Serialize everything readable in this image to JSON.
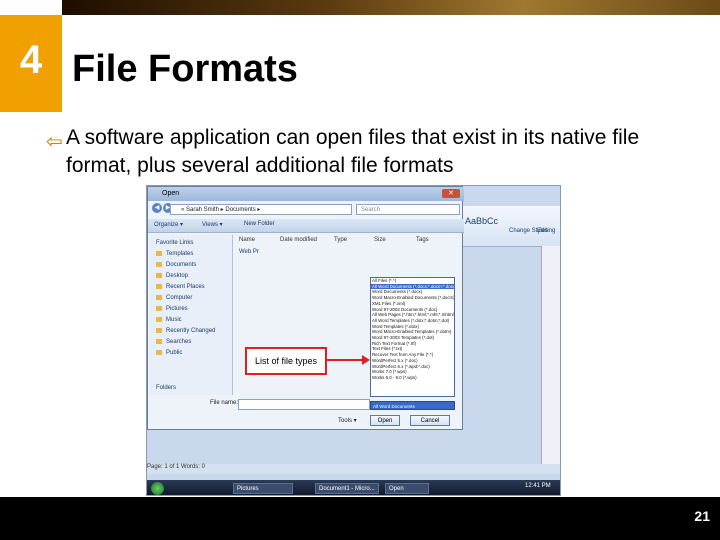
{
  "slide": {
    "chapter_number": "4",
    "title": "File Formats",
    "bullet": "A software application can open files that exist in its native file format, plus several additional file formats",
    "page_number": "21",
    "accent_color": "#f0a000"
  },
  "dialog": {
    "title": "Open",
    "close_glyph": "✕",
    "address": "« Sarah Smith ▸ Documents ▸",
    "search_placeholder": "Search",
    "toolbar": {
      "organize": "Organize ▾",
      "views": "Views ▾",
      "new_folder": "New Folder"
    },
    "favorite_links_header": "Favorite Links",
    "favorites": [
      "Templates",
      "Documents",
      "Desktop",
      "Recent Places",
      "Computer",
      "Pictures",
      "Music",
      "Recently Changed",
      "Searches",
      "Public"
    ],
    "folders_label": "Folders",
    "columns": [
      "Name",
      "Date modified",
      "Type",
      "Size",
      "Tags"
    ],
    "files": [
      "Web Pr"
    ],
    "file_name_label": "File name:",
    "tools_label": "Tools ▾",
    "file_types": [
      "All Files (*.*)",
      "All Word Documents (*.docx;*.docm;*.dotx;*.dotm;*.doc;*.dot;*.htm;*.html;*.rtf)",
      "Word Documents (*.docx)",
      "Word Macro-Enabled Documents (*.docm)",
      "XML Files (*.xml)",
      "Word 97-2003 Documents (*.doc)",
      "All Web Pages (*.htm;*.html;*.mht;*.mhtml)",
      "All Word Templates (*.dotx;*.dotm;*.dot)",
      "Word Templates (*.dotx)",
      "Word Macro-Enabled Templates (*.dotm)",
      "Word 97-2003 Templates (*.dot)",
      "Rich Text Format (*.rtf)",
      "Text Files (*.txt)",
      "Recover Text from Any File (*.*)",
      "WordPerfect 5.x (*.doc)",
      "WordPerfect 6.x (*.wpd;*.doc)",
      "Works 7.0 (*.wps)",
      "Works 6.0 - 9.0 (*.wps)"
    ],
    "file_type_selected": "All Word Documents",
    "open_label": "Open",
    "cancel_label": "Cancel"
  },
  "callout": {
    "label": "List of file types"
  },
  "word": {
    "ribbon": [
      "AaBbCc",
      "Change Styles",
      "Editing"
    ],
    "status": "Page: 1 of 1   Words: 0"
  },
  "taskbar": {
    "items": [
      "Pictures",
      "Document1 - Micro...",
      "Open"
    ],
    "clock": "12:41 PM"
  }
}
